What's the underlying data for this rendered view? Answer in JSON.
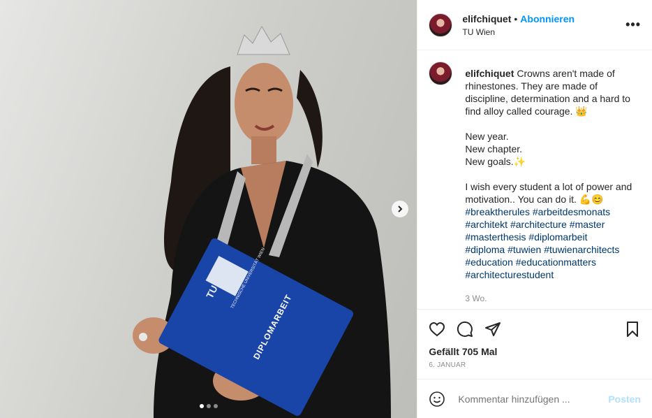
{
  "header": {
    "username": "elifchiquet",
    "separator": "•",
    "follow_label": "Abonnieren",
    "location": "TU Wien",
    "more_label": "•••"
  },
  "caption": {
    "username": "elifchiquet",
    "text": "Crowns aren't made of rhinestones. They are made of discipline, determination and a hard to find alloy called courage. 👑\n\nNew year.\nNew chapter.\nNew goals.✨\n\nI wish every student a lot of power and motivation.. You can do it. 💪😊\n",
    "hashtags": [
      "#breaktherules",
      "#arbeitdesmonats",
      "#architekt",
      "#architecture",
      "#master",
      "#masterthesis",
      "#diplomarbeit",
      "#diploma",
      "#tuwien",
      "#tuwienarchitects",
      "#education",
      "#educationmatters",
      "#architecturestudent"
    ],
    "age": "3 Wo."
  },
  "likes": "Gefällt 705 Mal",
  "date": "6. JANUAR",
  "comment_input": {
    "placeholder": "Kommentar hinzufügen ...",
    "post_label": "Posten"
  },
  "media": {
    "folder_text": [
      "TU",
      "TECHNISCHE UNIVERSITÄT WIEN",
      "DIPLOMARBEIT"
    ],
    "carousel": {
      "current": 1,
      "total": 3
    }
  },
  "colors": {
    "accent": "#0095f6",
    "hashtag": "#00376b",
    "post_disabled": "#b2dffc"
  }
}
